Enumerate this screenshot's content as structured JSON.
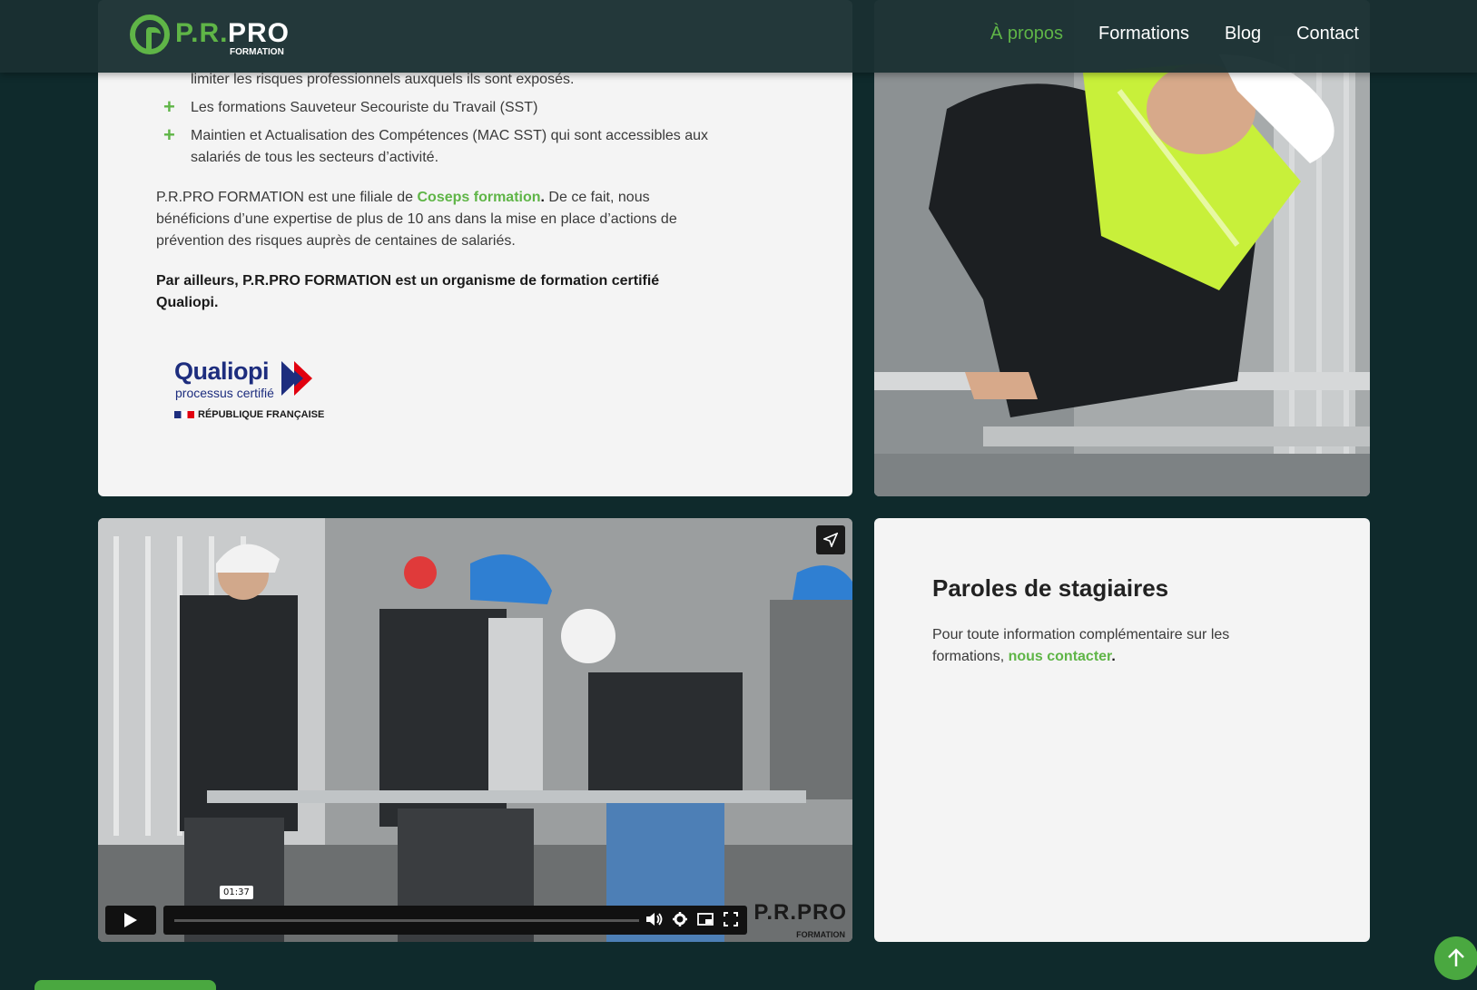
{
  "nav": {
    "logo": {
      "prefix": "P.R.",
      "main": "PRO",
      "sub": "FORMATION"
    },
    "links": [
      "À propos",
      "Formations",
      "Blog",
      "Contact"
    ],
    "active_link": "À propos",
    "accent_color": "#5fb547"
  },
  "about": {
    "list_first_line": "limiter les risques professionnels auxquels ils sont exposés.",
    "list_items": [
      "Les formations Sauveteur Secouriste du Travail (SST)",
      "Maintien et Actualisation des Compétences (MAC SST) qui sont accessibles aux salariés de tous les secteurs d’activité."
    ],
    "p1_before": "P.R.PRO FORMATION est une filiale de ",
    "p1_link": "Coseps formation",
    "p1_dot": ".",
    "p1_after": " De ce fait, nous bénéficions d’une expertise de plus de 10 ans dans la mise en place d’actions de prévention des risques auprès de centaines de salariés.",
    "p2_bold": "Par ailleurs, P.R.PRO FORMATION est un organisme de formation certifié Qualiopi.",
    "qualiopi": {
      "word": "Qualiopi",
      "subtitle": "processus certifié",
      "republic": "RÉPUBLIQUE FRANÇAISE"
    }
  },
  "video": {
    "time_tooltip": "01:37",
    "brand_main": "P.R.PRO",
    "brand_sub": "FORMATION",
    "controls_icons": [
      "play-icon",
      "volume-icon",
      "settings-icon",
      "pip-icon",
      "fullscreen-icon",
      "share-icon"
    ]
  },
  "testimonials": {
    "title": "Paroles de stagiaires",
    "text_before": "Pour toute information complémentaire sur les formations, ",
    "link": "nous contacter",
    "text_after": "."
  },
  "scroll_top_icon": "arrow-up-icon"
}
